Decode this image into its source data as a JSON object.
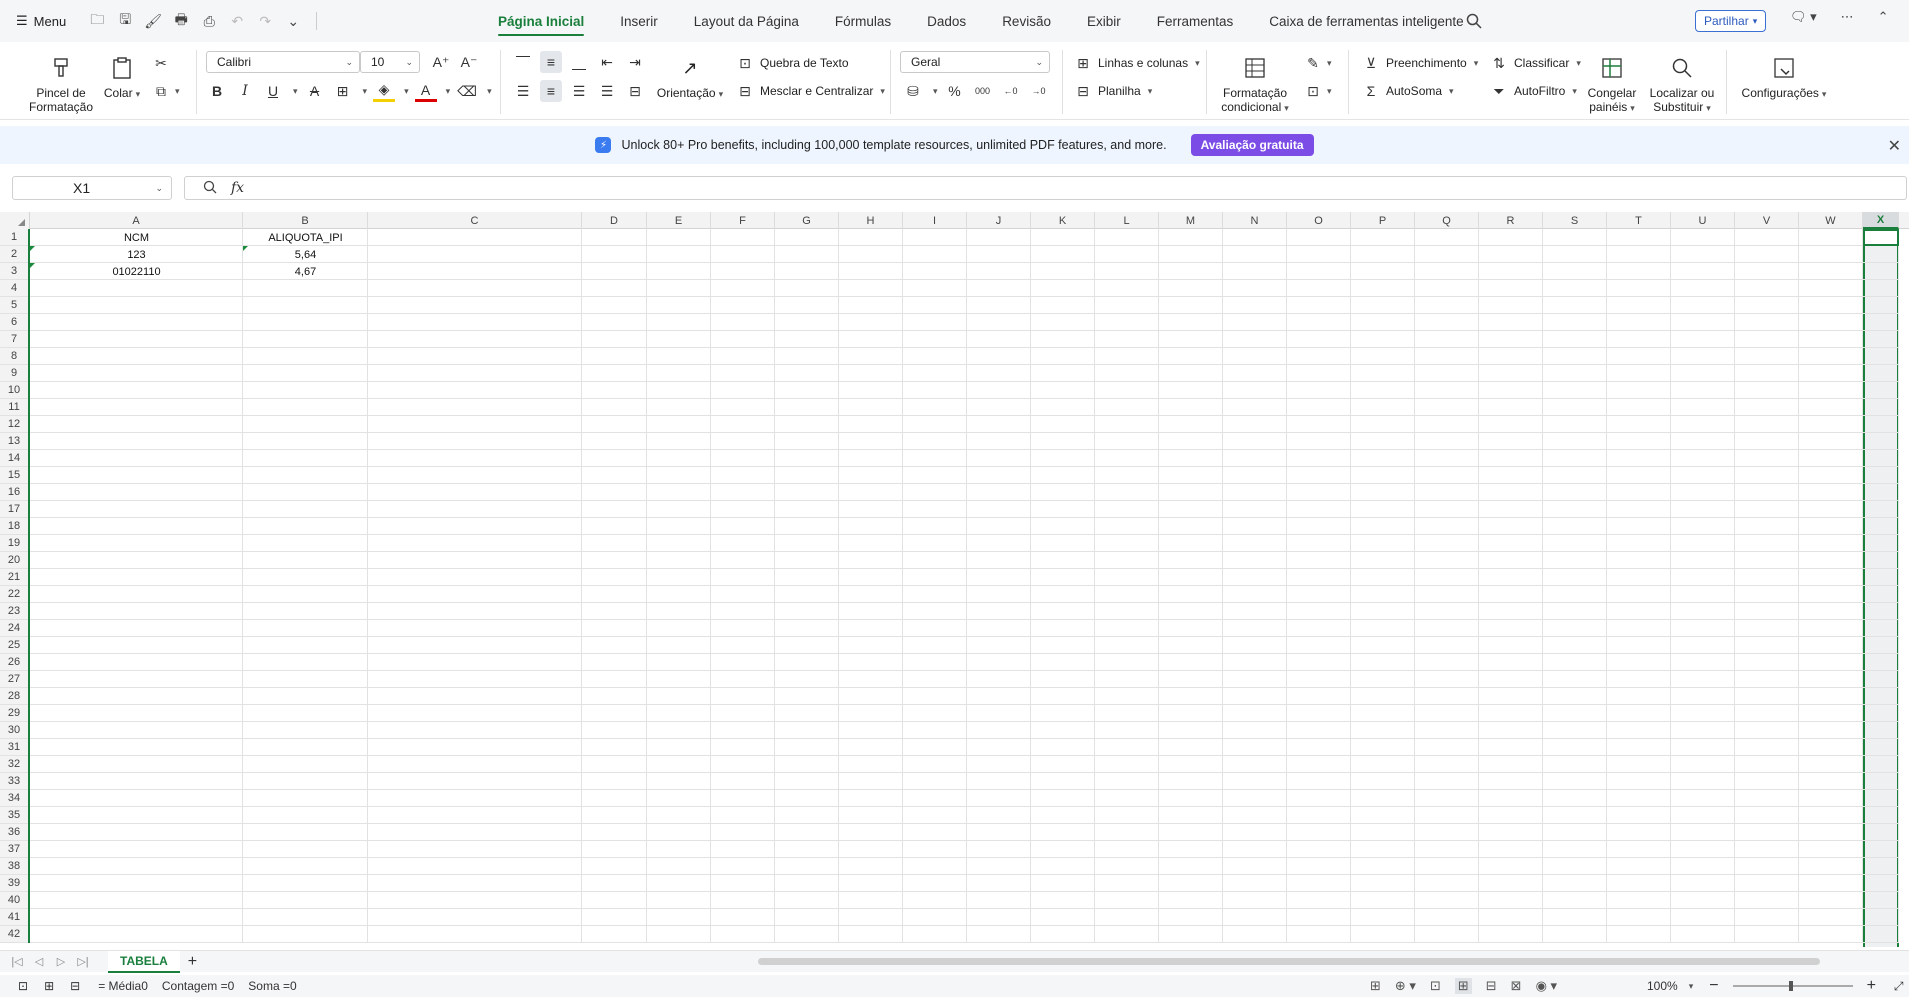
{
  "topbar": {
    "menu_label": "Menu",
    "tabs": [
      {
        "label": "Página Inicial",
        "active": true
      },
      {
        "label": "Inserir"
      },
      {
        "label": "Layout da Página"
      },
      {
        "label": "Fórmulas"
      },
      {
        "label": "Dados"
      },
      {
        "label": "Revisão"
      },
      {
        "label": "Exibir"
      },
      {
        "label": "Ferramentas"
      },
      {
        "label": "Caixa de ferramentas inteligente"
      }
    ],
    "share_label": "Partilhar"
  },
  "ribbon": {
    "format_painter": "Pincel de Formatação",
    "paste": "Colar",
    "font_name": "Calibri",
    "font_size": "10",
    "wrap_text": "Quebra de Texto",
    "orientation": "Orientação",
    "merge_center": "Mesclar e Centralizar",
    "number_format": "Geral",
    "rows_cols": "Linhas e colunas",
    "worksheet": "Planilha",
    "conditional_format_l1": "Formatação",
    "conditional_format_l2": "condicional",
    "fill": "Preenchimento",
    "autosum": "AutoSoma",
    "sort": "Classificar",
    "autofilter": "AutoFiltro",
    "freeze_l1": "Congelar",
    "freeze_l2": "painéis",
    "find_l1": "Localizar ou",
    "find_l2": "Substituir",
    "settings": "Configurações"
  },
  "promo": {
    "text": "Unlock 80+ Pro benefits, including 100,000 template resources, unlimited PDF features, and more.",
    "button": "Avaliação gratuita"
  },
  "formula_bar": {
    "name_box": "X1",
    "fx_label": "fx",
    "formula": ""
  },
  "sheet": {
    "columns": [
      "A",
      "B",
      "C",
      "D",
      "E",
      "F",
      "G",
      "H",
      "I",
      "J",
      "K",
      "L",
      "M",
      "N",
      "O",
      "P",
      "Q",
      "R",
      "S",
      "T",
      "U",
      "V",
      "W",
      "X"
    ],
    "selected_column": "X",
    "row_count": 42,
    "cells": [
      {
        "col": 0,
        "row": 0,
        "value": "NCM"
      },
      {
        "col": 1,
        "row": 0,
        "value": "ALIQUOTA_IPI"
      },
      {
        "col": 0,
        "row": 1,
        "value": "123",
        "flag": true
      },
      {
        "col": 1,
        "row": 1,
        "value": "5,64",
        "flag": true
      },
      {
        "col": 0,
        "row": 2,
        "value": "01022110",
        "flag": true
      }
    ],
    "cell_b3": "4,67"
  },
  "sheetbar": {
    "tab_name": "TABELA"
  },
  "status": {
    "average": "= Média0",
    "count": "Contagem =0",
    "sum": "Soma =0",
    "zoom": "100%"
  },
  "colors": {
    "accent": "#1a7f3c",
    "promo_button": "#7b4de6"
  }
}
